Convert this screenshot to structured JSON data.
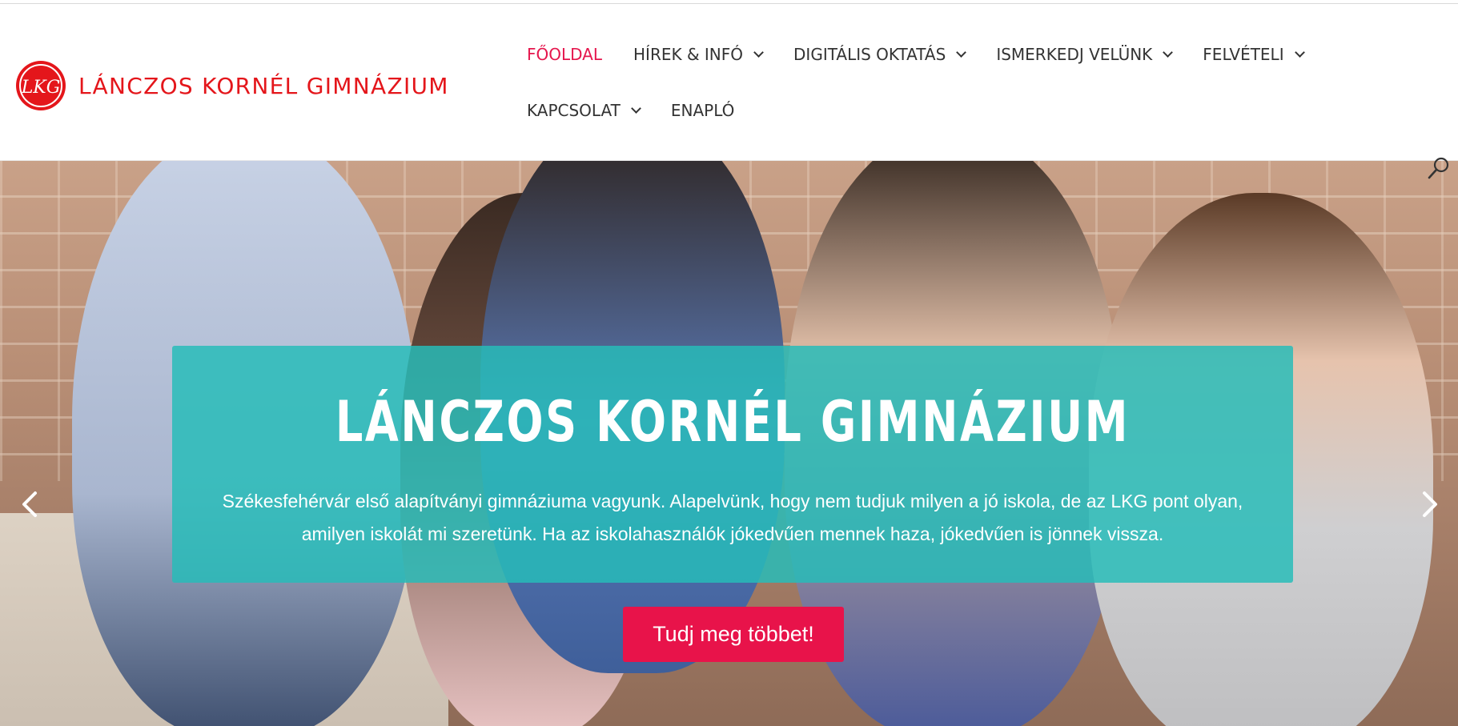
{
  "header": {
    "logo": {
      "mark_text": "LKG",
      "name": "LÁNCZOS KORNÉL GIMNÁZIUM",
      "color": "#e4161b"
    },
    "nav": {
      "items": [
        {
          "label": "FŐOLDAL",
          "active": true,
          "has_dropdown": false
        },
        {
          "label": "HÍREK & INFÓ",
          "active": false,
          "has_dropdown": true
        },
        {
          "label": "DIGITÁLIS OKTATÁS",
          "active": false,
          "has_dropdown": true
        },
        {
          "label": "ISMERKEDJ VELÜNK",
          "active": false,
          "has_dropdown": true
        },
        {
          "label": "FELVÉTELI",
          "active": false,
          "has_dropdown": true
        },
        {
          "label": "KAPCSOLAT",
          "active": false,
          "has_dropdown": true
        },
        {
          "label": "ENAPLÓ",
          "active": false,
          "has_dropdown": false
        }
      ],
      "active_color": "#e5164d",
      "icons": {
        "dropdown": "chevron-down-icon",
        "search": "search-icon"
      }
    }
  },
  "hero": {
    "title": "LÁNCZOS KORNÉL GIMNÁZIUM",
    "text": "Székesfehérvár első alapítványi gimnáziuma vagyunk. Alapelvünk, hogy nem tudjuk milyen a jó iskola, de az LKG pont olyan, amilyen iskolát mi szeretünk. Ha az iskolahasználók jókedvűen mennek haza, jókedvűen is jönnek vissza.",
    "button_label": "Tudj meg többet!",
    "caption_color": "#26bcb9",
    "button_color": "#e8134a",
    "icons": {
      "prev": "chevron-left-icon",
      "next": "chevron-right-icon"
    }
  }
}
